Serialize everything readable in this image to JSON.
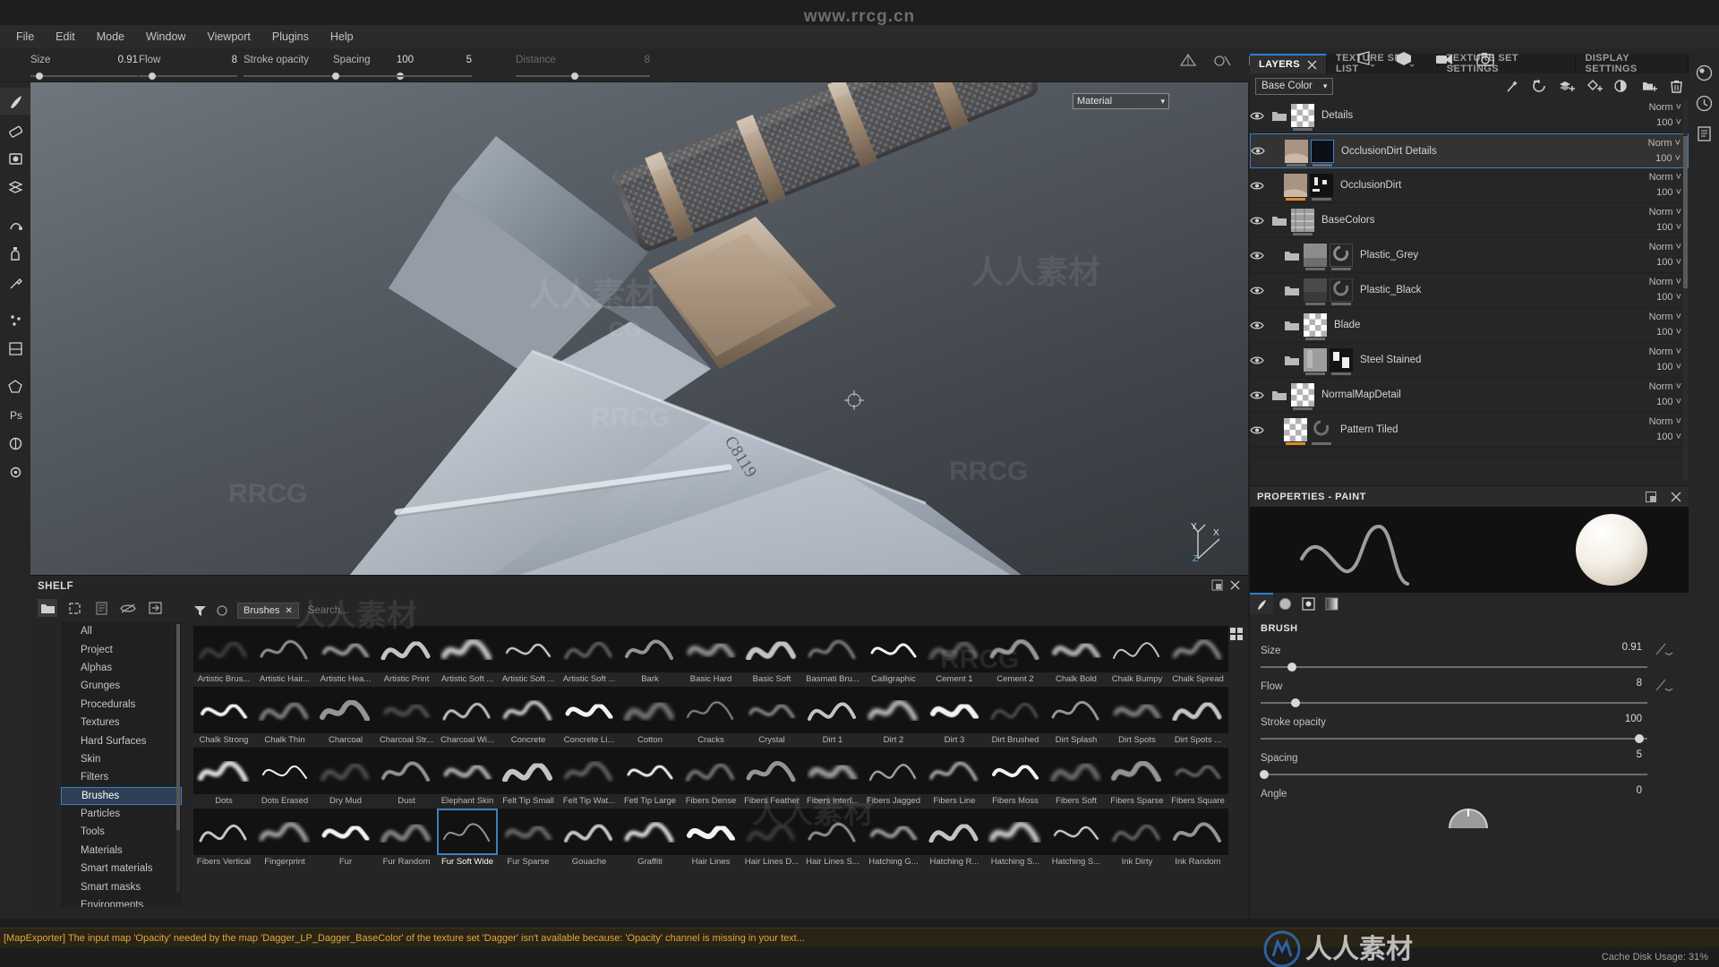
{
  "watermarks": {
    "top": "www.rrcg.cn",
    "marks": [
      "人人素材",
      "RRCG",
      "人人素材",
      "RRCG",
      "人人素材",
      "RRCG",
      "人人素材",
      "CG",
      "RRCG"
    ]
  },
  "menubar": {
    "items": [
      "File",
      "Edit",
      "Mode",
      "Window",
      "Viewport",
      "Plugins",
      "Help"
    ]
  },
  "toolbar": {
    "params": [
      {
        "label": "Size",
        "value": "0.91",
        "knob_pct": 8
      },
      {
        "label": "Flow",
        "value": "8",
        "knob_pct": 14
      },
      {
        "label": "Stroke opacity",
        "value": "100",
        "knob_pct": 92
      },
      {
        "label": "Spacing",
        "value": "5",
        "knob_pct": 2
      },
      {
        "label": "Distance",
        "value": "8",
        "knob_pct": 44,
        "dim": true
      }
    ],
    "icons": [
      "symmetry-icon",
      "mirror-icon",
      "projection-icon"
    ]
  },
  "viewport": {
    "material_combo": "Material",
    "view_icons": [
      "perspective-icon",
      "cube-icon",
      "camera-icon",
      "snapshot-icon"
    ],
    "axis_labels": [
      "Y",
      "X",
      "Z"
    ]
  },
  "left_rail": {
    "items": [
      "paint-brush-tool",
      "eraser-tool",
      "projection-tool",
      "geometry-decal-tool",
      "smudge-tool",
      "clone-tool",
      "eyedropper-tool",
      "particles-tool",
      "planar-fill-tool",
      "polygon-fill-tool",
      "photoshop-tool",
      "baking-tool",
      "settings-tool"
    ]
  },
  "right_rail": {
    "items": [
      "viewer-icon",
      "history-icon",
      "log-icon"
    ]
  },
  "shelf": {
    "title": "SHELF",
    "tools": [
      "folder-icon",
      "new-icon",
      "document-icon",
      "hide-icon",
      "import-icon"
    ],
    "filter_chip": "Brushes",
    "search_placeholder": "Search...",
    "categories": [
      "All",
      "Project",
      "Alphas",
      "Grunges",
      "Procedurals",
      "Textures",
      "Hard Surfaces",
      "Skin",
      "Filters",
      "Brushes",
      "Particles",
      "Tools",
      "Materials",
      "Smart materials",
      "Smart masks",
      "Environments"
    ],
    "selected_category": "Brushes",
    "selected_brush": "Fur Soft Wide",
    "brushes": [
      "Artistic Brus...",
      "Artistic Hair...",
      "Artistic Hea...",
      "Artistic Print",
      "Artistic Soft ...",
      "Artistic Soft ...",
      "Artistic Soft ...",
      "Bark",
      "Basic Hard",
      "Basic Soft",
      "Basmati Bru...",
      "Calligraphic",
      "Cement 1",
      "Cement 2",
      "Chalk Bold",
      "Chalk Bumpy",
      "Chalk Spread",
      "Chalk Strong",
      "Chalk Thin",
      "Charcoal",
      "Charcoal Str...",
      "Charcoal Wi...",
      "Concrete",
      "Concrete Li...",
      "Cotton",
      "Cracks",
      "Crystal",
      "Dirt 1",
      "Dirt 2",
      "Dirt 3",
      "Dirt Brushed",
      "Dirt Splash",
      "Dirt Spots",
      "Dirt Spots ...",
      "Dots",
      "Dots Erased",
      "Dry Mud",
      "Dust",
      "Elephant Skin",
      "Felt Tip Small",
      "Felt Tip Wat...",
      "Fetl Tip Large",
      "Fibers Dense",
      "Fibers Feather",
      "Fibers Interl...",
      "Fibers Jagged",
      "Fibers Line",
      "Fibers Moss",
      "Fibers Soft",
      "Fibers Sparse",
      "Fibers Square",
      "Fibers Vertical",
      "Fingerprint",
      "Fur",
      "Fur Random",
      "Fur Soft Wide",
      "Fur Sparse",
      "Gouache",
      "Graffiti",
      "Hair Lines",
      "Hair Lines D...",
      "Hair Lines S...",
      "Hatching G...",
      "Hatching R...",
      "Hatching S...",
      "Hatching S...",
      "Ink Dirty",
      "Ink Random"
    ]
  },
  "dock": {
    "tabs": [
      {
        "label": "LAYERS",
        "active": true,
        "closable": true
      },
      {
        "label": "TEXTURE SET LIST",
        "active": false
      },
      {
        "label": "TEXTURE SET SETTINGS",
        "active": false
      },
      {
        "label": "DISPLAY SETTINGS",
        "active": false
      }
    ],
    "channel": "Base Color",
    "toolbar_icons": [
      "magic-wand-icon",
      "reload-icon",
      "add-fill-layer-icon",
      "add-paint-layer-icon",
      "add-mask-icon",
      "add-folder-icon",
      "trash-icon"
    ],
    "layers": [
      {
        "name": "Details",
        "type": "folder",
        "blend": "Norm",
        "opacity": "100",
        "selected": false,
        "thumb": "checker",
        "indent": 0
      },
      {
        "name": "OcclusionDirt Details",
        "type": "layer",
        "blend": "Norm",
        "opacity": "100",
        "selected": true,
        "thumb": "tan-mask-dark",
        "indent": 1
      },
      {
        "name": "OcclusionDirt",
        "type": "layer",
        "blend": "Norm",
        "opacity": "100",
        "selected": false,
        "thumb": "tan-mask-gen",
        "indent": 1
      },
      {
        "name": "BaseColors",
        "type": "folder",
        "blend": "Norm",
        "opacity": "100",
        "selected": false,
        "thumb": "noise",
        "indent": 0
      },
      {
        "name": "Plastic_Grey",
        "type": "folder",
        "blend": "Norm",
        "opacity": "100",
        "selected": false,
        "thumb": "grey-smart",
        "indent": 1
      },
      {
        "name": "Plastic_Black",
        "type": "folder",
        "blend": "Norm",
        "opacity": "100",
        "selected": false,
        "thumb": "dark-smart",
        "indent": 1
      },
      {
        "name": "Blade",
        "type": "folder",
        "blend": "Norm",
        "opacity": "100",
        "selected": false,
        "thumb": "checker",
        "indent": 1
      },
      {
        "name": "Steel Stained",
        "type": "folder",
        "blend": "Norm",
        "opacity": "100",
        "selected": false,
        "thumb": "steel-mask",
        "indent": 1
      },
      {
        "name": "NormalMapDetail",
        "type": "folder",
        "blend": "Norm",
        "opacity": "100",
        "selected": false,
        "thumb": "checker",
        "indent": 0
      },
      {
        "name": "Pattern Tiled",
        "type": "layer",
        "blend": "Norm",
        "opacity": "100",
        "selected": false,
        "thumb": "checker-orange",
        "indent": 1
      }
    ]
  },
  "properties": {
    "title": "PROPERTIES - PAINT",
    "tabs": [
      "brush-tip-icon",
      "alpha-icon",
      "stencil-icon",
      "gradient-icon"
    ],
    "section_title": "BRUSH",
    "params": [
      {
        "label": "Size",
        "value": "0.91",
        "knob_pct": 8,
        "has_curve": true
      },
      {
        "label": "Flow",
        "value": "8",
        "knob_pct": 9,
        "has_curve": true
      },
      {
        "label": "Stroke opacity",
        "value": "100",
        "knob_pct": 98,
        "has_curve": false
      },
      {
        "label": "Spacing",
        "value": "5",
        "knob_pct": 1,
        "has_curve": false
      },
      {
        "label": "Angle",
        "value": "0",
        "knob_pct": 0,
        "has_curve": false
      }
    ]
  },
  "status": {
    "message": "[MapExporter] The input map 'Opacity' needed by the map 'Dagger_LP_Dagger_BaseColor' of the texture set 'Dagger' isn't available because: 'Opacity' channel is missing in your text...",
    "cache": "Cache Disk Usage: 31%"
  },
  "colors": {
    "accent": "#2b7fd4",
    "selection": "#3d7fc1",
    "panel": "#262626",
    "panel_dark": "#1f1f1f",
    "status_text": "#e0a83c",
    "orange": "#e08828"
  }
}
